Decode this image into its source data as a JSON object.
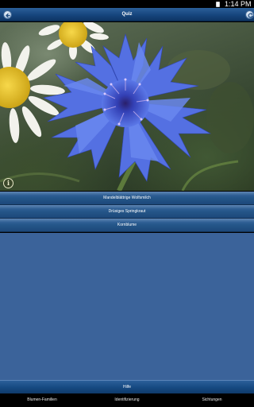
{
  "status": {
    "time": "1:14 PM"
  },
  "header": {
    "title": "Quiz",
    "back_icon": "back-arrow-icon",
    "refresh_icon": "refresh-icon"
  },
  "image": {
    "info_label": "i"
  },
  "answers": [
    {
      "label": "Mandelblättrige Wolfsmilch"
    },
    {
      "label": "Drüsiges Springkraut"
    },
    {
      "label": "Kornblume"
    }
  ],
  "help": {
    "label": "Hilfe"
  },
  "tabs": [
    {
      "label": "Blumen-Familien"
    },
    {
      "label": "Identifizierung"
    },
    {
      "label": "Sichtungen"
    }
  ],
  "colors": {
    "bar": "#16457d",
    "background": "#3b639a",
    "cornflower": "#3f52d6"
  }
}
